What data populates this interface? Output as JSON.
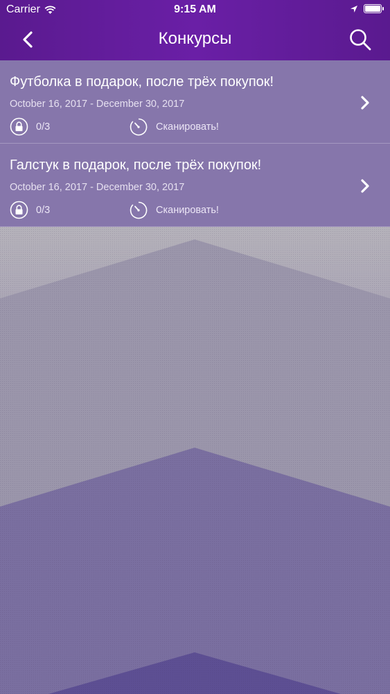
{
  "status_bar": {
    "carrier": "Carrier",
    "time": "9:15 AM"
  },
  "nav": {
    "title": "Конкурсы",
    "back_icon": "chevron-left-icon",
    "search_icon": "search-icon"
  },
  "contests": [
    {
      "title": "Футболка в подарок, после трёх покупок!",
      "dates": "October 16, 2017 - December 30, 2017",
      "progress": "0/3",
      "scan_label": "Сканировать!"
    },
    {
      "title": "Галстук в подарок, после трёх покупок!",
      "dates": "October 16, 2017 - December 30, 2017",
      "progress": "0/3",
      "scan_label": "Сканировать!"
    }
  ],
  "colors": {
    "header": "#6a1fa6",
    "row_background": "#7864a5"
  }
}
